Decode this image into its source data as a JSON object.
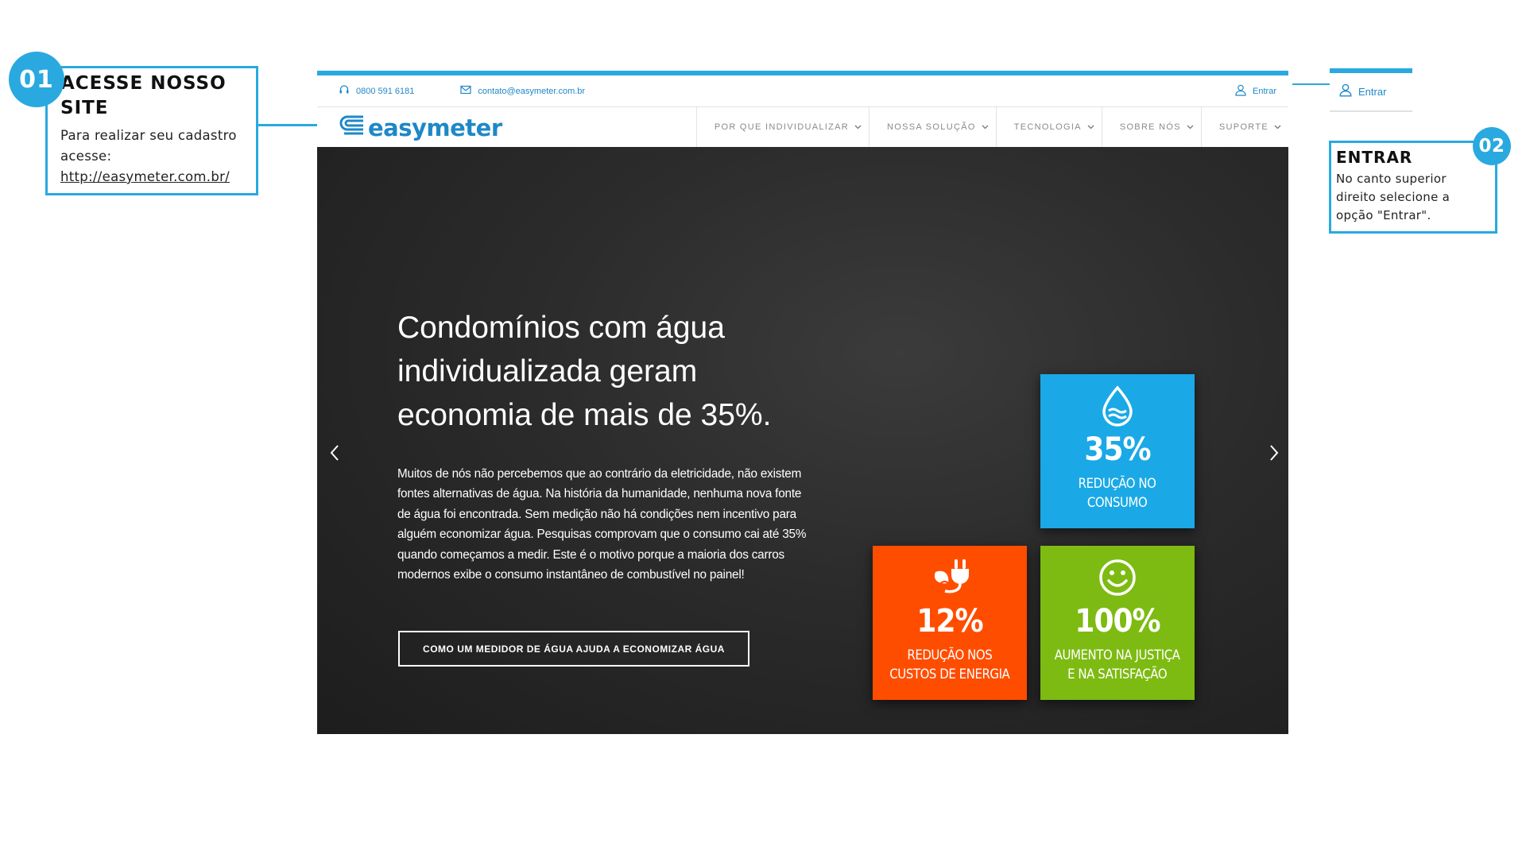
{
  "step1": {
    "number": "01",
    "title": "ACESSE NOSSO SITE",
    "text": "Para realizar seu cadastro acesse:",
    "link": "http://easymeter.com.br/"
  },
  "step2": {
    "number": "02",
    "title": "ENTRAR",
    "text": "No canto superior direito selecione a opção \"Entrar\"."
  },
  "zoom": {
    "login_label": "Entrar"
  },
  "site": {
    "topbar": {
      "phone": "0800 591 6181",
      "email": "contato@easymeter.com.br",
      "login_label": "Entrar"
    },
    "logo": {
      "text": "easymeter"
    },
    "menu": [
      {
        "label": "POR QUE INDIVIDUALIZAR"
      },
      {
        "label": "NOSSA SOLUÇÃO"
      },
      {
        "label": "TECNOLOGIA"
      },
      {
        "label": "SOBRE NÓS"
      },
      {
        "label": "SUPORTE"
      }
    ],
    "hero": {
      "title": "Condomínios com água individualizada geram economia de mais de 35%.",
      "body": "Muitos de nós não percebemos que ao contrário da eletricidade, não existem fontes alternativas de água. Na história da humanidade, nenhuma nova fonte de água foi encontrada. Sem medição não há condições nem incentivo para alguém economizar água. Pesquisas comprovam que o consumo cai até 35% quando começamos a medir. Este é o motivo porque a maioria dos carros modernos exibe o consumo instantâneo de combustível no painel!",
      "button": "COMO UM MEDIDOR DE ÁGUA AJUDA A ECONOMIZAR ÁGUA"
    },
    "tiles": [
      {
        "value": "35%",
        "label_line1": "REDUÇÃO NO",
        "label_line2": "CONSUMO",
        "color": "#1aa9e6",
        "icon": "water-drop-icon"
      },
      {
        "value": "12%",
        "label_line1": "REDUÇÃO NOS",
        "label_line2": "CUSTOS DE ENERGIA",
        "color": "#ff4d00",
        "icon": "plug-leaf-icon"
      },
      {
        "value": "100%",
        "label_line1": "AUMENTO NA JUSTIÇA",
        "label_line2": "E NA SATISFAÇÃO",
        "color": "#7dbb12",
        "icon": "smiley-icon"
      }
    ]
  },
  "colors": {
    "accent": "#29a9e0",
    "link_blue": "#1e88c7",
    "hero_bg": "#262626"
  }
}
